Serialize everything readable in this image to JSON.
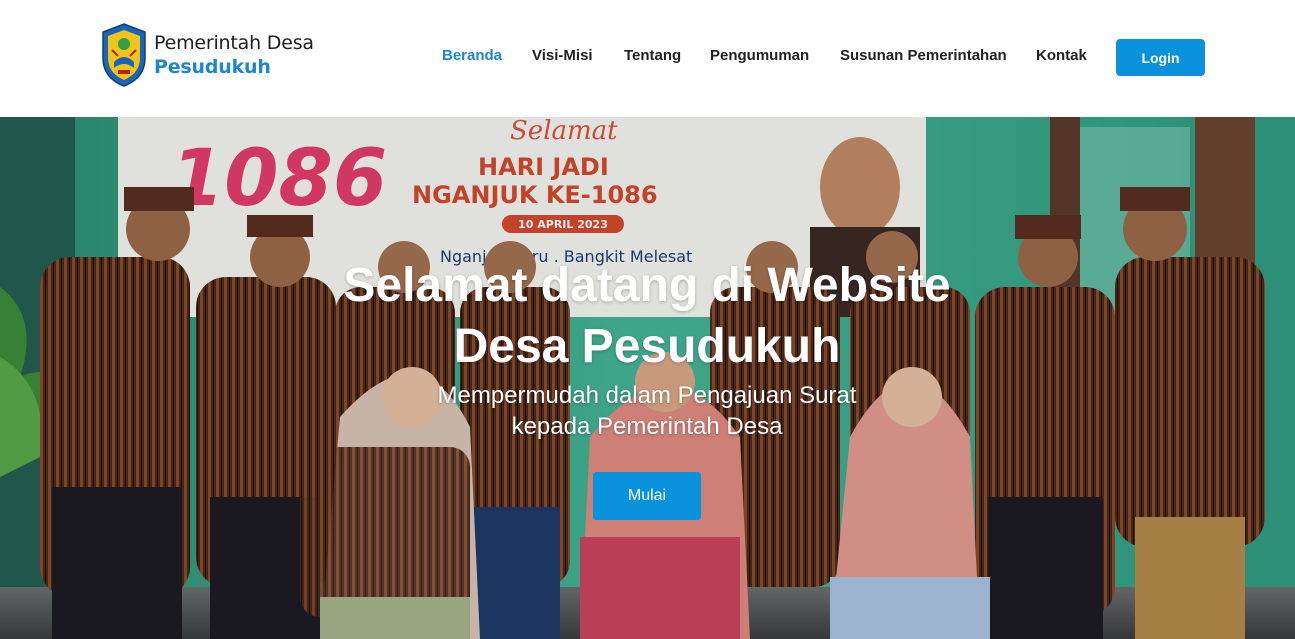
{
  "brand": {
    "line1": "Pemerintah Desa",
    "line2": "Pesudukuh"
  },
  "nav": {
    "items": [
      {
        "label": "Beranda",
        "active": true
      },
      {
        "label": "Visi-Misi",
        "active": false
      },
      {
        "label": "Tentang",
        "active": false
      },
      {
        "label": "Pengumuman",
        "active": false
      },
      {
        "label": "Susunan Pemerintahan",
        "active": false
      },
      {
        "label": "Kontak",
        "active": false
      }
    ],
    "login_label": "Login"
  },
  "hero": {
    "title_line1": "Selamat datang di Website",
    "title_line2": "Desa Pesudukuh",
    "subtitle_line1": "Mempermudah dalam Pengajuan Surat",
    "subtitle_line2": "kepada Pemerintah Desa",
    "cta_label": "Mulai",
    "banner": {
      "number": "1086",
      "script": "Selamat",
      "line1": "HARI JADI",
      "line2": "NGANJUK KE-1086",
      "date": "10 APRIL 2023",
      "tagline": "Nganjuk Baru . Bangkit Melesat"
    }
  },
  "colors": {
    "accent": "#1d87c9",
    "button": "#0a93dc",
    "nav_text": "#222222",
    "wall": "#3aa88a"
  },
  "icons": {
    "emblem": "village-emblem-icon"
  }
}
